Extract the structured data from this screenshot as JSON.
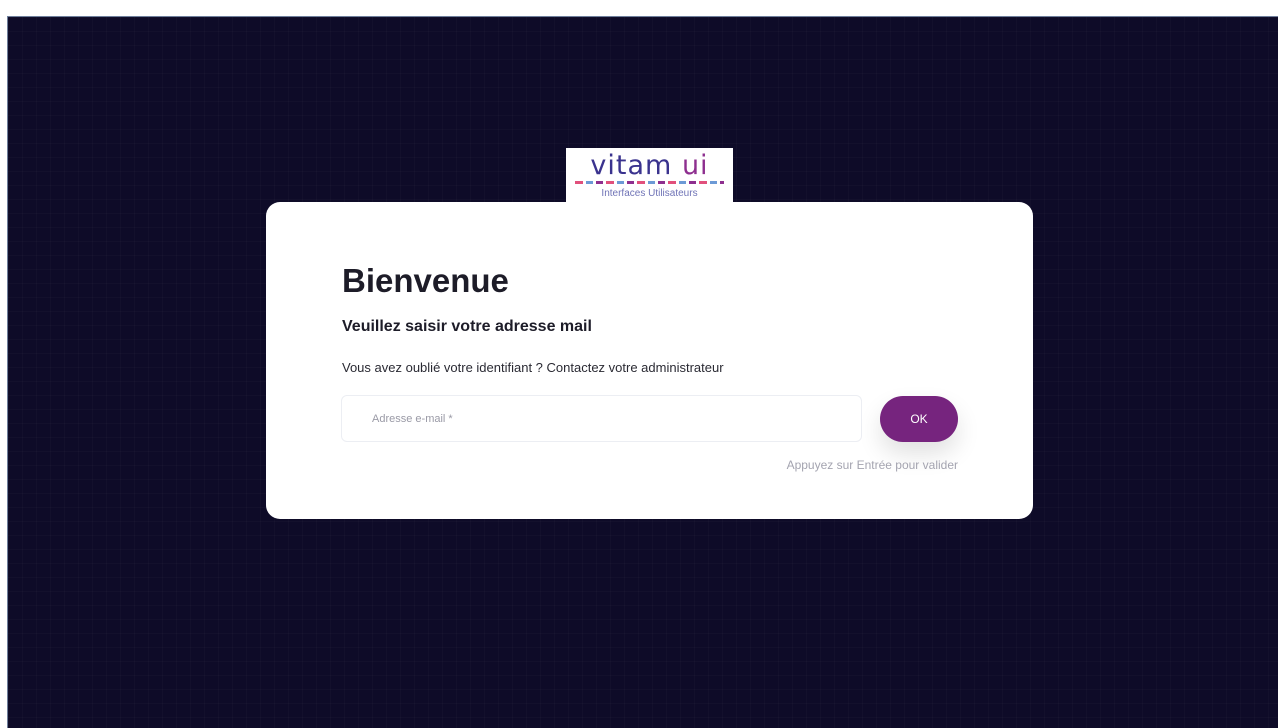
{
  "logo": {
    "wordmark_main": "vitam",
    "wordmark_accent": "ui",
    "subtitle": "Interfaces Utilisateurs"
  },
  "login": {
    "title": "Bienvenue",
    "subtitle": "Veuillez saisir votre adresse mail",
    "help_text": "Vous avez oublié votre identifiant ? Contactez votre administrateur",
    "email_placeholder": "Adresse e-mail *",
    "email_value": "",
    "submit_label": "OK",
    "enter_hint": "Appuyez sur Entrée pour valider"
  },
  "colors": {
    "background": "#0e0b28",
    "card": "#ffffff",
    "primary_button": "#76247e",
    "logo_primary": "#3a338e",
    "logo_accent": "#8e2f8f"
  }
}
